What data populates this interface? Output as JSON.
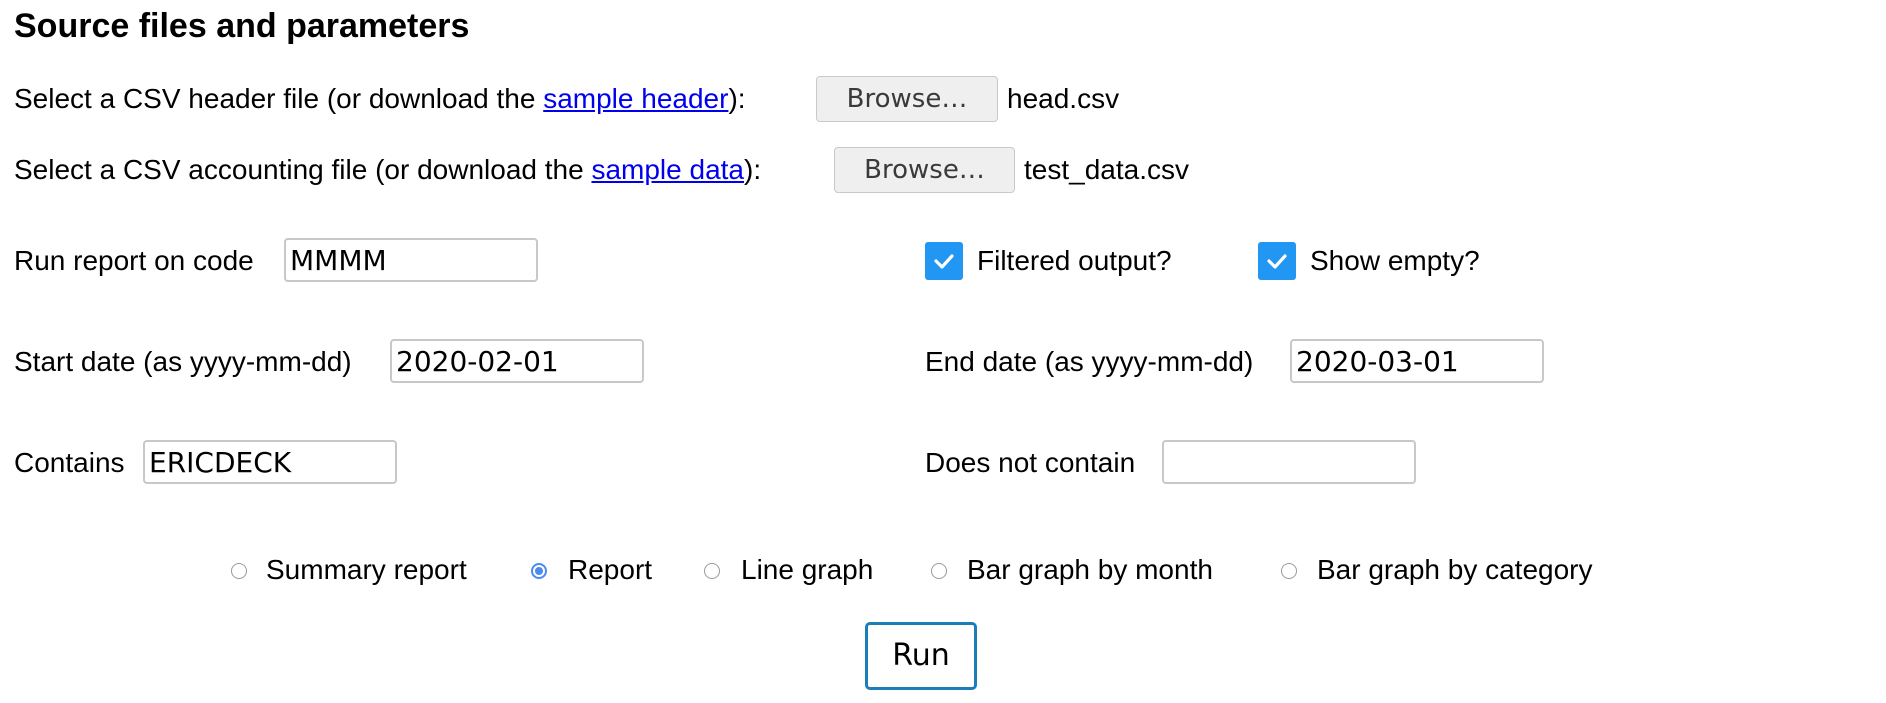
{
  "heading": "Source files and parameters",
  "header_file": {
    "prefix": "Select a CSV header file (or download the ",
    "link": "sample header",
    "suffix": "):",
    "button": "Browse…",
    "filename": "head.csv"
  },
  "data_file": {
    "prefix": "Select a CSV accounting file (or download the ",
    "link": "sample data",
    "suffix": "):",
    "button": "Browse…",
    "filename": "test_data.csv"
  },
  "code": {
    "label": "Run report on code",
    "value": "MMMM"
  },
  "filtered_output": {
    "label": "Filtered output?",
    "checked": true
  },
  "show_empty": {
    "label": "Show empty?",
    "checked": true
  },
  "start_date": {
    "label": "Start date (as yyyy-mm-dd)",
    "value": "2020-02-01"
  },
  "end_date": {
    "label": "End date (as yyyy-mm-dd)",
    "value": "2020-03-01"
  },
  "contains": {
    "label": "Contains",
    "value": "ERICDECK"
  },
  "not_contains": {
    "label": "Does not contain",
    "value": ""
  },
  "report_types": [
    {
      "label": "Summary report",
      "selected": false
    },
    {
      "label": "Report",
      "selected": true
    },
    {
      "label": "Line graph",
      "selected": false
    },
    {
      "label": "Bar graph by month",
      "selected": false
    },
    {
      "label": "Bar graph by category",
      "selected": false
    }
  ],
  "run_button": "Run",
  "colors": {
    "checkbox": "#2196f3",
    "radio_selected": "#4a8bf0",
    "link": "#0000ee",
    "run_border": "#1a7fb8"
  }
}
